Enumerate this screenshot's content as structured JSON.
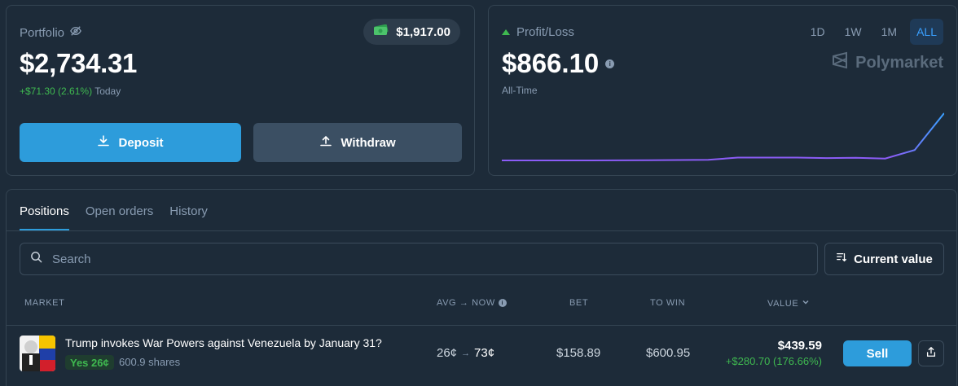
{
  "portfolio": {
    "label": "Portfolio",
    "value": "$2,734.31",
    "change": "+$71.30 (2.61%)",
    "change_period": "Today",
    "cash": "$1,917.00",
    "deposit_label": "Deposit",
    "withdraw_label": "Withdraw"
  },
  "pnl": {
    "label": "Profit/Loss",
    "value": "$866.10",
    "period": "All-Time",
    "ranges": [
      "1D",
      "1W",
      "1M",
      "ALL"
    ],
    "active_range": "ALL",
    "brand": "Polymarket",
    "series": [
      0,
      0,
      0,
      0,
      0.2,
      0.5,
      0.8,
      1.2,
      6,
      6,
      6,
      5,
      5.5,
      4,
      22,
      100
    ]
  },
  "positions": {
    "tabs": [
      "Positions",
      "Open orders",
      "History"
    ],
    "active_tab": "Positions",
    "search_placeholder": "Search",
    "sort_label": "Current value",
    "columns": {
      "market": "MARKET",
      "avg_now": "AVG → NOW",
      "bet": "BET",
      "to_win": "TO WIN",
      "value": "VALUE"
    },
    "rows": [
      {
        "title": "Trump invokes War Powers against Venezuela by January 31?",
        "outcome": "Yes 26¢",
        "shares": "600.9 shares",
        "avg": "26¢",
        "now": "73¢",
        "bet": "$158.89",
        "to_win": "$600.95",
        "value": "$439.59",
        "value_change": "+$280.70 (176.66%)",
        "sell_label": "Sell"
      }
    ]
  },
  "colors": {
    "accent": "#2d9cdb",
    "positive": "#3fb950",
    "chart_line": "#8b5cf6"
  }
}
